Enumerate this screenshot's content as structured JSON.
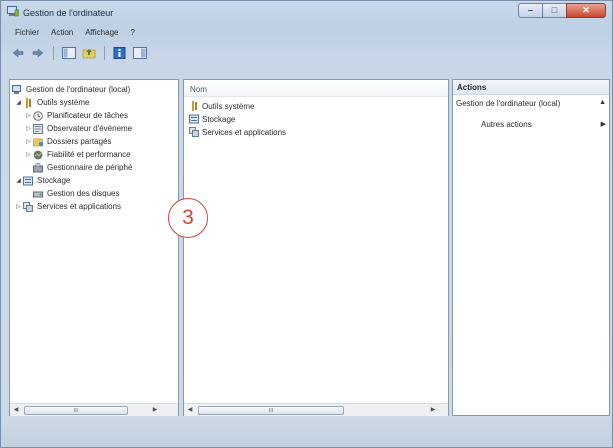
{
  "window": {
    "title": "Gestion de l'ordinateur",
    "controls": {
      "minimize": "–",
      "maximize": "□",
      "close": "✕"
    }
  },
  "menu": [
    "Fichier",
    "Action",
    "Affichage",
    "?"
  ],
  "toolbar": {
    "buttons": [
      "back-arrow",
      "forward-arrow",
      "console-tree",
      "up-folder",
      "help",
      "properties-panel"
    ]
  },
  "tree": {
    "root": "Gestion de l'ordinateur (local)",
    "items": [
      {
        "label": "Outils système",
        "icon": "tools-icon"
      },
      {
        "label": "Planificateur de tâches",
        "icon": "clock-icon"
      },
      {
        "label": "Observateur d'événeme",
        "icon": "event-viewer-icon"
      },
      {
        "label": "Dossiers partagés",
        "icon": "shared-folder-icon"
      },
      {
        "label": "Fiabilité et performance",
        "icon": "performance-icon"
      },
      {
        "label": "Gestionnaire de périphé",
        "icon": "device-manager-icon"
      },
      {
        "label": "Stockage",
        "icon": "storage-icon"
      },
      {
        "label": "Gestion des disques",
        "icon": "disk-management-icon"
      },
      {
        "label": "Services et applications",
        "icon": "services-icon"
      }
    ]
  },
  "center": {
    "column_header": "Nom",
    "items": [
      "Outils système",
      "Stockage",
      "Services et applications"
    ]
  },
  "actions": {
    "header": "Actions",
    "section": "Gestion de l'ordinateur (local)",
    "more": "Autres actions",
    "section_arrow": "▲",
    "more_arrow": "▶"
  },
  "scrollbar": {
    "left_arrow": "◀",
    "right_arrow": "▶",
    "grip": "III"
  },
  "callout": "3",
  "colors": {
    "accent": "#d0463b",
    "title_bar": "#c9d8ea",
    "close_button": "#c8472b"
  }
}
